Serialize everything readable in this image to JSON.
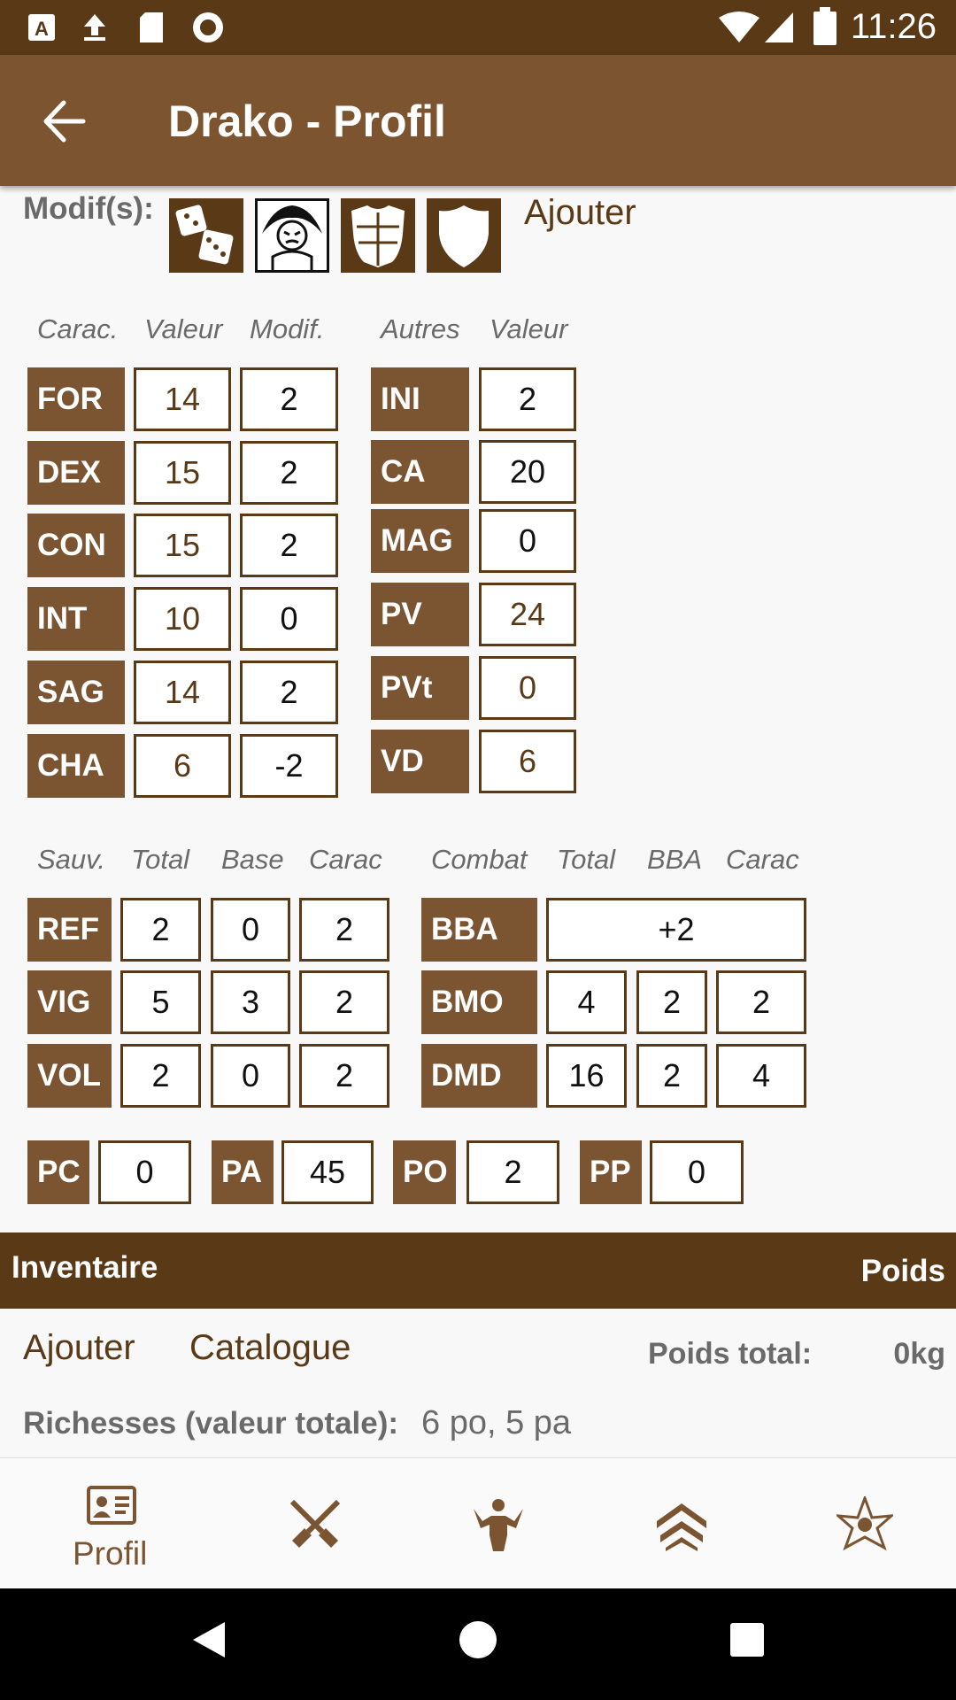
{
  "status": {
    "time": "11:26"
  },
  "appbar": {
    "title": "Drako - Profil"
  },
  "modifs": {
    "label": "Modif(s):",
    "add": "Ajouter",
    "icons": [
      "dice-icon",
      "rage-icon",
      "armor-icon",
      "shield-icon"
    ]
  },
  "carac": {
    "headers": [
      "Carac.",
      "Valeur",
      "Modif."
    ],
    "rows": [
      {
        "name": "FOR",
        "value": "14",
        "mod": "2"
      },
      {
        "name": "DEX",
        "value": "15",
        "mod": "2"
      },
      {
        "name": "CON",
        "value": "15",
        "mod": "2"
      },
      {
        "name": "INT",
        "value": "10",
        "mod": "0"
      },
      {
        "name": "SAG",
        "value": "14",
        "mod": "2"
      },
      {
        "name": "CHA",
        "value": "6",
        "mod": "-2"
      }
    ]
  },
  "autres": {
    "headers": [
      "Autres",
      "Valeur"
    ],
    "rows": [
      {
        "name": "INI",
        "value": "2"
      },
      {
        "name": "CA",
        "value": "20"
      },
      {
        "name": "MAG",
        "value": "0"
      },
      {
        "name": "PV",
        "value": "24"
      },
      {
        "name": "PVt",
        "value": "0"
      },
      {
        "name": "VD",
        "value": "6"
      }
    ]
  },
  "sauv": {
    "headers": [
      "Sauv.",
      "Total",
      "Base",
      "Carac"
    ],
    "rows": [
      {
        "name": "REF",
        "total": "2",
        "base": "0",
        "carac": "2"
      },
      {
        "name": "VIG",
        "total": "5",
        "base": "3",
        "carac": "2"
      },
      {
        "name": "VOL",
        "total": "2",
        "base": "0",
        "carac": "2"
      }
    ]
  },
  "combat": {
    "headers": [
      "Combat",
      "Total",
      "BBA",
      "Carac"
    ],
    "bba": {
      "name": "BBA",
      "value": "+2"
    },
    "rows": [
      {
        "name": "BMO",
        "total": "4",
        "bba": "2",
        "carac": "2"
      },
      {
        "name": "DMD",
        "total": "16",
        "bba": "2",
        "carac": "4"
      }
    ]
  },
  "money": [
    {
      "name": "PC",
      "value": "0"
    },
    {
      "name": "PA",
      "value": "45"
    },
    {
      "name": "PO",
      "value": "2"
    },
    {
      "name": "PP",
      "value": "0"
    }
  ],
  "inventory": {
    "title": "Inventaire",
    "weight_header": "Poids",
    "add": "Ajouter",
    "catalogue": "Catalogue",
    "total_weight_label": "Poids total:",
    "total_weight_value": "0kg",
    "wealth_label": "Richesses (valeur totale):",
    "wealth_value": "6 po, 5 pa"
  },
  "bottom_nav": {
    "profile_label": "Profil"
  },
  "colors": {
    "dark_brown": "#5a3a16",
    "brown": "#7b5531"
  }
}
